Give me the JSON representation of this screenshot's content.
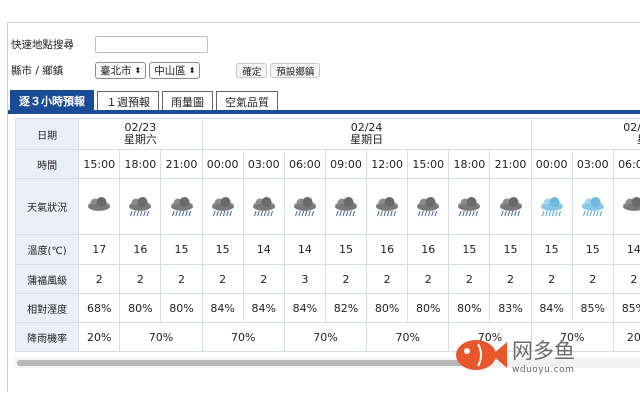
{
  "search": {
    "label": "快速地點搜尋",
    "value": "",
    "placeholder": ""
  },
  "city_row": {
    "label": "縣市 / 鄉鎮",
    "city": "臺北市",
    "district": "中山區",
    "confirm_label": "確定",
    "default_label": "預設鄉鎮"
  },
  "tabs": [
    "逐３小時預報",
    "１週預報",
    "雨量圖",
    "空氣品質"
  ],
  "table": {
    "row_headers": [
      "日期",
      "時間",
      "天氣狀況",
      "溫度(℃)",
      "蒲福風級",
      "相對溼度",
      "降雨機率"
    ],
    "dates": [
      {
        "date": "02/23",
        "weekday": "星期六"
      },
      {
        "date": "02/24",
        "weekday": "星期日"
      },
      {
        "date": "02/2",
        "weekday": "星"
      }
    ],
    "times": [
      "15:00",
      "18:00",
      "21:00",
      "00:00",
      "03:00",
      "06:00",
      "09:00",
      "12:00",
      "15:00",
      "18:00",
      "21:00",
      "00:00",
      "03:00",
      "06:00"
    ],
    "weather_icons": [
      "cloudy-icon",
      "rain-icon",
      "rain-icon",
      "rain-icon",
      "rain-icon",
      "rain-icon",
      "rain-icon",
      "rain-icon",
      "rain-icon",
      "rain-icon",
      "rain-icon",
      "light-rain-icon",
      "light-rain-icon",
      "cloudy-icon"
    ],
    "temps": [
      "17",
      "16",
      "15",
      "15",
      "14",
      "14",
      "15",
      "16",
      "16",
      "15",
      "15",
      "15",
      "15",
      "14"
    ],
    "wind": [
      "2",
      "2",
      "2",
      "2",
      "2",
      "3",
      "2",
      "2",
      "2",
      "2",
      "2",
      "2",
      "2",
      "2"
    ],
    "humidity": [
      "68%",
      "80%",
      "80%",
      "84%",
      "84%",
      "84%",
      "82%",
      "80%",
      "80%",
      "80%",
      "83%",
      "84%",
      "85%",
      "85%"
    ],
    "rain_prob": [
      "20%",
      "70%",
      "70%",
      "70%",
      "70%",
      "70%",
      "70%",
      "20"
    ]
  },
  "colors": {
    "tab_active": "#1b4c97",
    "date_text": "#b0306e",
    "header_bg": "#eaf0f7"
  },
  "watermark": {
    "name": "网多鱼",
    "url": "wduoyu.com"
  }
}
